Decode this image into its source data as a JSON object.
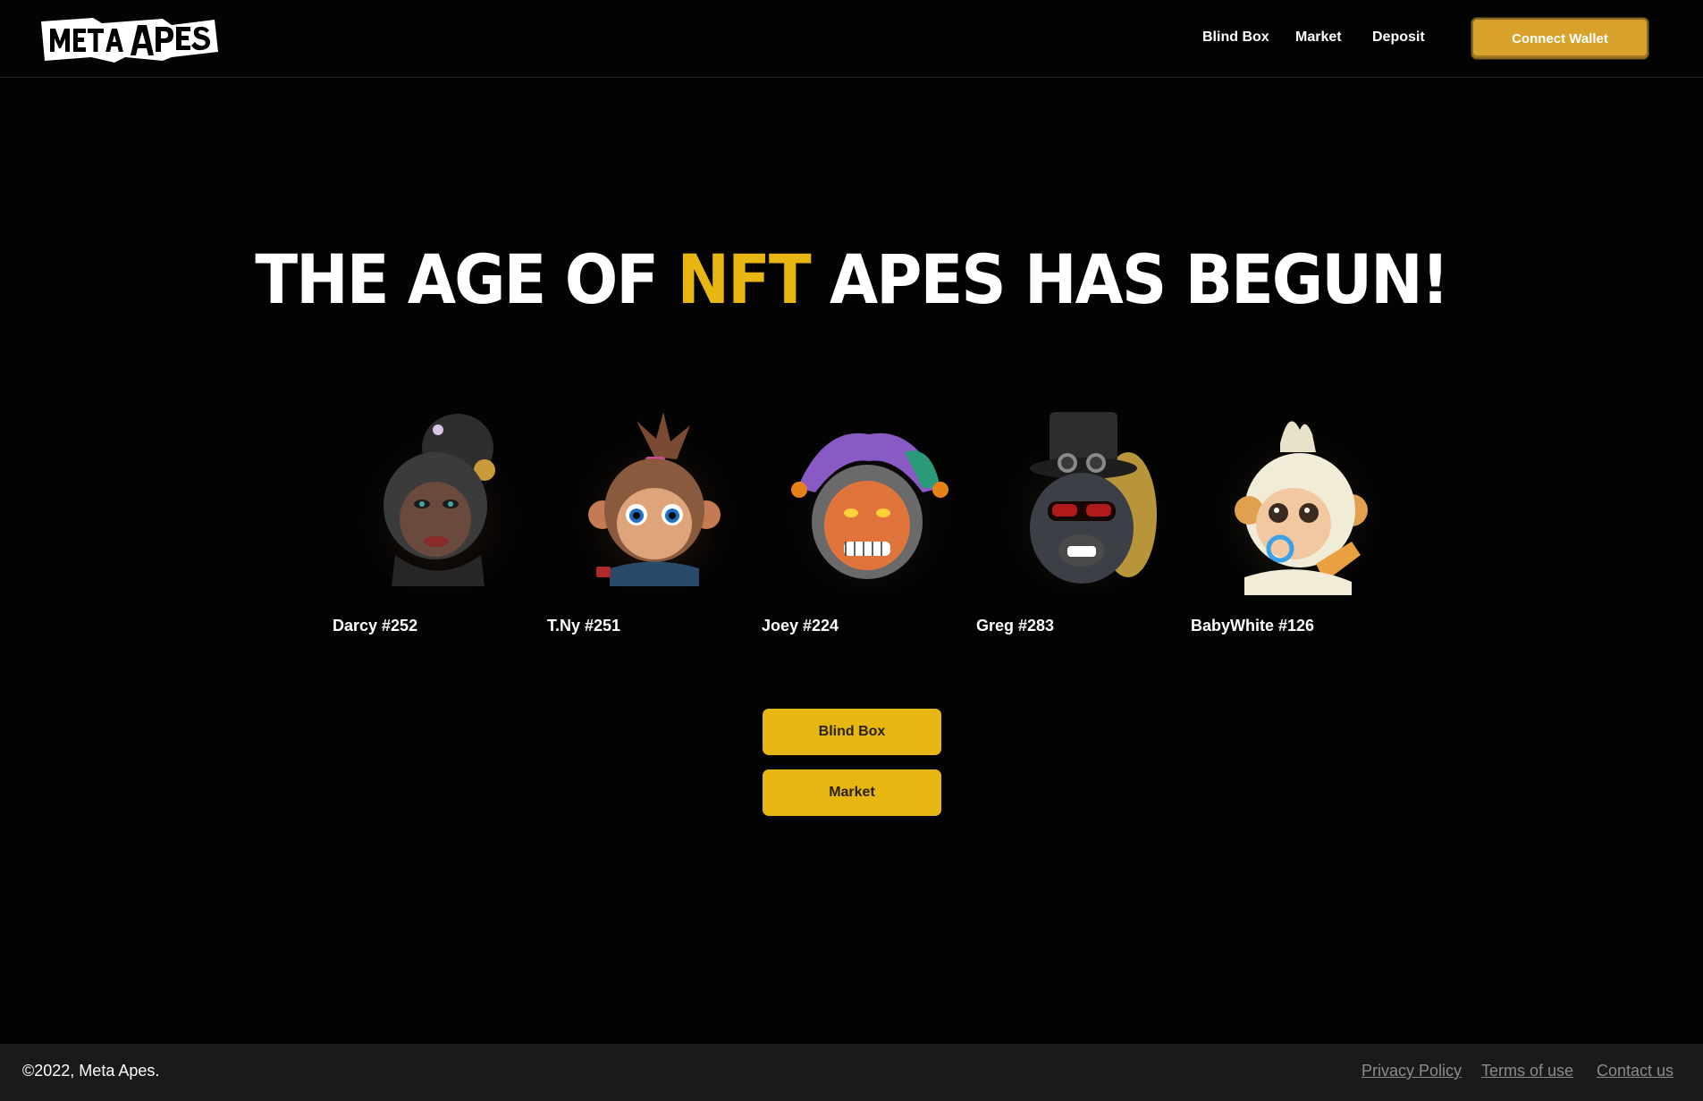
{
  "header": {
    "logo_text": "META APES",
    "nav": [
      {
        "label": "Blind Box"
      },
      {
        "label": "Market"
      },
      {
        "label": "Deposit"
      }
    ],
    "connect_label": "Connect Wallet"
  },
  "hero": {
    "title_pre": "THE AGE OF ",
    "title_accent": "NFT",
    "title_post": " APES HAS BEGUN!"
  },
  "apes": [
    {
      "name": "Darcy #252"
    },
    {
      "name": "T.Ny #251"
    },
    {
      "name": "Joey #224"
    },
    {
      "name": "Greg #283"
    },
    {
      "name": "BabyWhite #126"
    }
  ],
  "cta": {
    "blind_box_label": "Blind Box",
    "market_label": "Market"
  },
  "footer": {
    "copyright": "©2022, Meta Apes.",
    "links": [
      {
        "label": "Privacy Policy"
      },
      {
        "label": "Terms of use"
      },
      {
        "label": "Contact us"
      }
    ]
  },
  "colors": {
    "background": "#030303",
    "accent": "#e8b611",
    "connect_button": "#d9a22c",
    "footer_bg": "#1a1a1a",
    "footer_link": "#8c8c8c"
  }
}
